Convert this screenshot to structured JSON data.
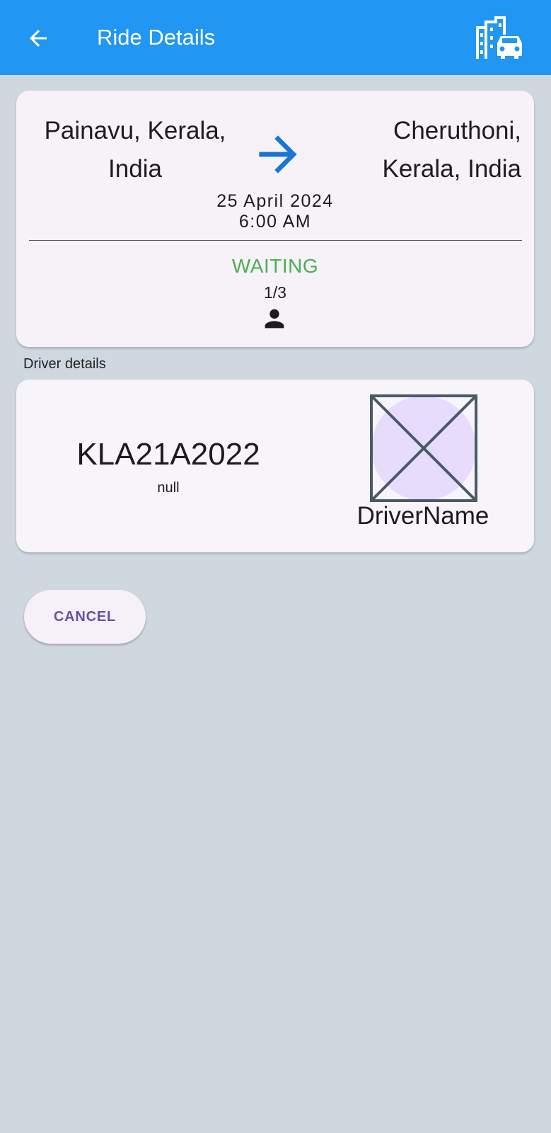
{
  "appbar": {
    "title": "Ride Details",
    "back_icon": "arrow-back-icon",
    "action_icon": "city-car-icon",
    "color": "#2196f3"
  },
  "ride": {
    "origin": "Painavu, Kerala, India",
    "destination": "Cheruthoni, Kerala, India",
    "date": "25 April 2024",
    "time": "6:00 AM",
    "status": "WAITING",
    "status_color": "#4caf50",
    "seats": "1/3",
    "seat_icon": "person-icon"
  },
  "driver": {
    "section_label": "Driver details",
    "vehicle_number": "KLA21A2022",
    "vehicle_sub": "null",
    "avatar_icon": "broken-image-icon",
    "name": "DriverName"
  },
  "actions": {
    "cancel_label": "CANCEL"
  }
}
